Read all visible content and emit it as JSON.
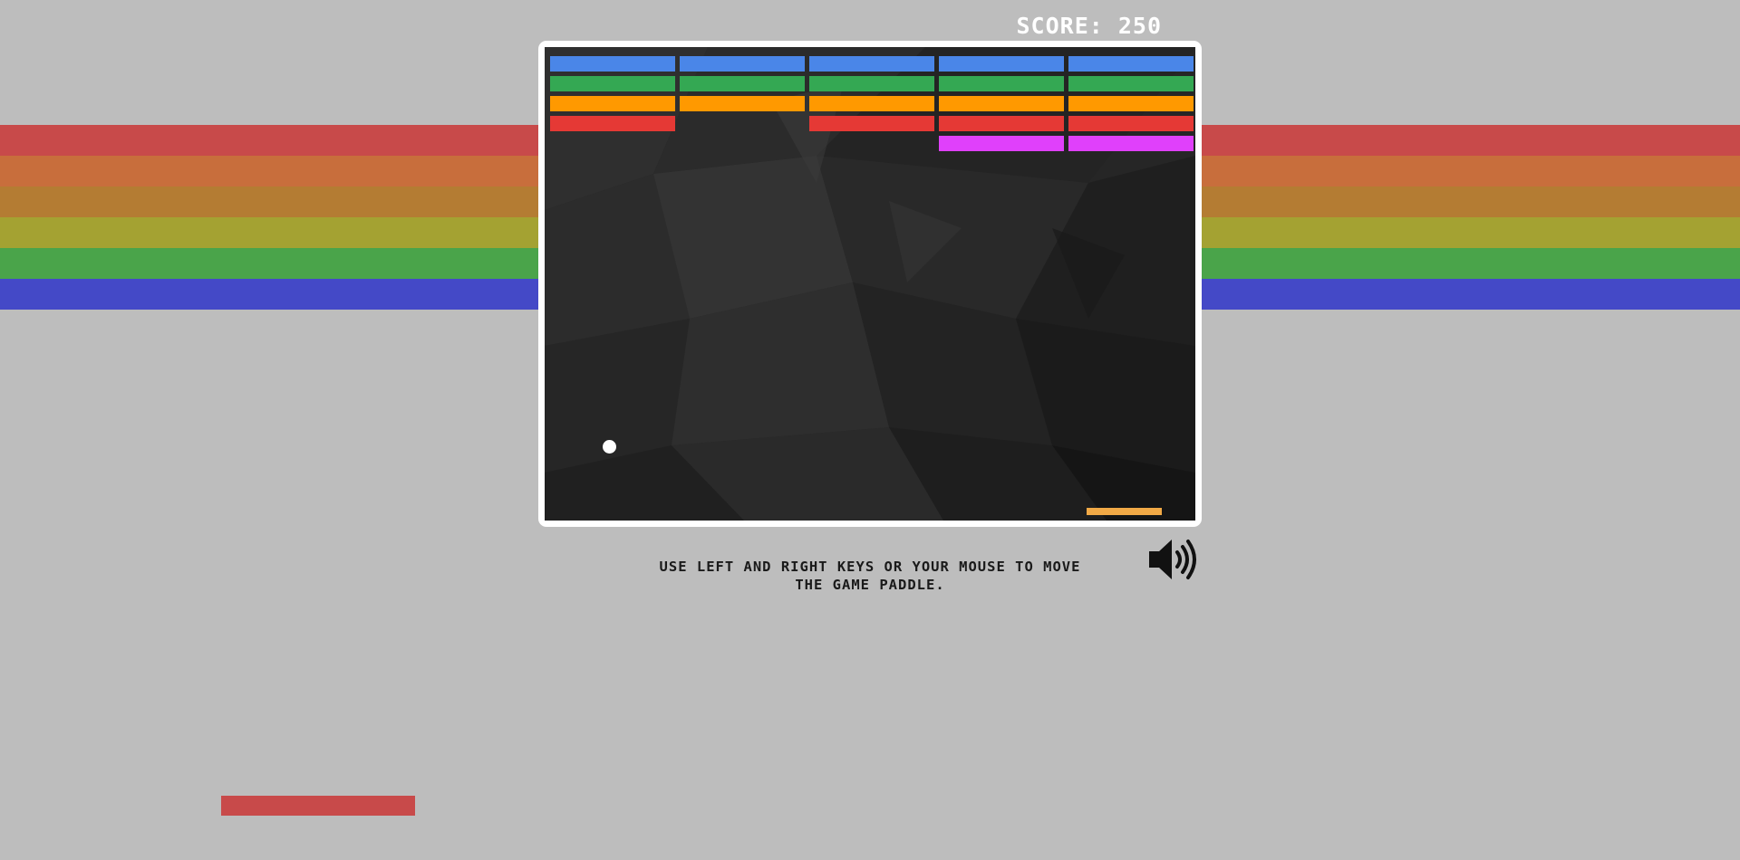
{
  "score": {
    "label": "SCORE:",
    "value": "250",
    "text": "SCORE: 250"
  },
  "instructions": {
    "line1": "USE LEFT AND RIGHT KEYS OR YOUR MOUSE TO MOVE",
    "line2": "THE GAME PADDLE."
  },
  "sound_toggle": {
    "icon": "speaker-volume-icon",
    "state": "on"
  },
  "colors": {
    "page_background": "#bdbdbd",
    "frame": "#ffffff",
    "canvas_background": "#2a2a2a",
    "ball": "#ffffff",
    "paddle": "#f1a946",
    "bottom_bar": "#c84a4a",
    "rainbow": [
      "#c84a4a",
      "#c86e3c",
      "#b47c33",
      "#a4a232",
      "#4aa44a",
      "#4449c7"
    ],
    "brick_colors": {
      "blue": "#4a86e8",
      "green": "#34a853",
      "orange": "#ff9900",
      "red": "#e53935",
      "magenta": "#e040fb"
    }
  },
  "bricks": {
    "columns": 5,
    "rows": [
      [
        "blue",
        "blue",
        "blue",
        "blue",
        "blue"
      ],
      [
        "green",
        "green",
        "green",
        "green",
        "green"
      ],
      [
        "orange",
        "orange",
        "orange",
        "orange",
        "orange"
      ],
      [
        "red",
        null,
        "red",
        "red",
        "red"
      ],
      [
        null,
        null,
        null,
        "magenta",
        "magenta"
      ]
    ]
  }
}
